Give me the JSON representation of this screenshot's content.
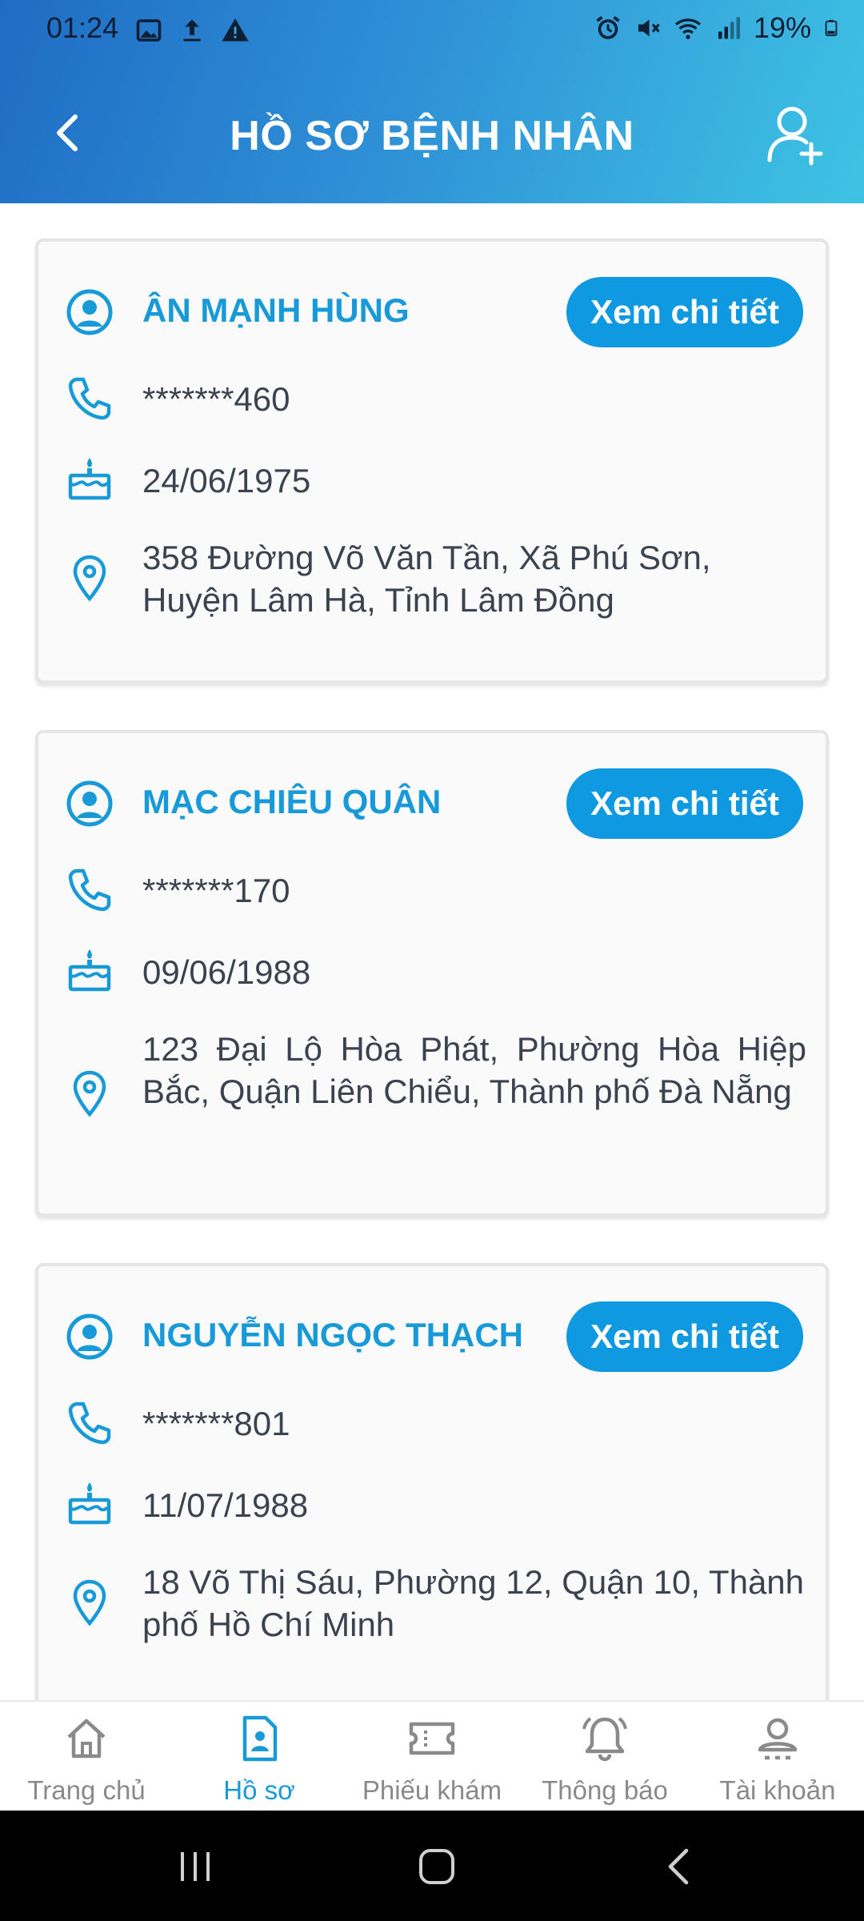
{
  "status_bar": {
    "time": "01:24",
    "battery": "19%",
    "left_icons": [
      "image-icon",
      "upload-icon",
      "warning-icon"
    ],
    "right_icons": [
      "alarm-icon",
      "mute-icon",
      "wifi-icon",
      "signal-icon",
      "battery-icon"
    ]
  },
  "header": {
    "title": "HỒ SƠ BỆNH NHÂN",
    "back_icon": "chevron-left-icon",
    "action_icon": "add-user-icon"
  },
  "colors": {
    "accent": "#189ad8",
    "button": "#0f99e0",
    "header_start": "#1f6cc4",
    "header_end": "#3ec3e4",
    "text": "#3c4350",
    "nav_inactive": "#8a8a8a"
  },
  "patients": [
    {
      "name": "ÂN MẠNH HÙNG",
      "button": "Xem chi tiết",
      "phone": "*******460",
      "birthday": "24/06/1975",
      "address": "358 Đường Võ Văn Tần, Xã Phú Sơn, Huyện Lâm Hà, Tỉnh Lâm Đồng"
    },
    {
      "name": "MẠC CHIÊU QUÂN",
      "button": "Xem chi tiết",
      "phone": "*******170",
      "birthday": "09/06/1988",
      "address": "123 Đại Lộ Hòa Phát, Phường Hòa Hiệp Bắc, Quận Liên Chiểu, Thành phố Đà Nẵng"
    },
    {
      "name": "NGUYỄN NGỌC THẠCH",
      "button": "Xem chi tiết",
      "phone": "*******801",
      "birthday": "11/07/1988",
      "address": "18 Võ Thị Sáu, Phường 12, Quận 10, Thành phố Hồ Chí Minh"
    }
  ],
  "bottom_nav": [
    {
      "label": "Trang chủ",
      "icon": "home-icon",
      "active": false
    },
    {
      "label": "Hồ sơ",
      "icon": "profile-file-icon",
      "active": true
    },
    {
      "label": "Phiếu khám",
      "icon": "ticket-icon",
      "active": false
    },
    {
      "label": "Thông báo",
      "icon": "bell-icon",
      "active": false
    },
    {
      "label": "Tài khoản",
      "icon": "account-icon",
      "active": false
    }
  ],
  "system_nav": [
    "recent-apps-icon",
    "home-button-icon",
    "back-icon"
  ]
}
